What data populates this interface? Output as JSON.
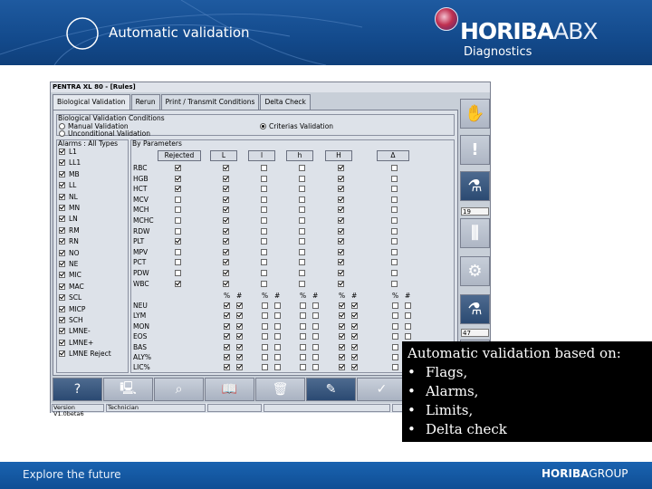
{
  "slide": {
    "title": "Automatic validation",
    "logo_bold": "HORIBA",
    "logo_light": "ABX",
    "logo_sub": "Diagnostics",
    "footer_text": "Explore the future",
    "footer_logo_bold": "HORIBA",
    "footer_logo_light": "GROUP"
  },
  "app": {
    "title": "PENTRA XL 80 - [Rules]",
    "tabs": [
      "Biological Validation",
      "Rerun",
      "Print / Transmit Conditions",
      "Delta Check"
    ],
    "conditions_label": "Biological Validation Conditions",
    "radio": {
      "manual": "Manual Validation",
      "unconditional": "Unconditional Validation",
      "criterias": "Criterias Validation"
    },
    "alarms_label": "Alarms : All Types",
    "alarms": [
      "L1",
      "LL1",
      "MB",
      "LL",
      "NL",
      "MN",
      "LN",
      "RM",
      "RN",
      "NO",
      "NE",
      "MIC",
      "MAC",
      "SCL",
      "MICP",
      "SCH",
      "LMNE-",
      "LMNE+",
      "LMNE Reject"
    ],
    "params_label": "By Parameters",
    "columns": [
      "Rejected",
      "L",
      "l",
      "h",
      "H",
      "Δ"
    ],
    "params_top": [
      "RBC",
      "HGB",
      "HCT",
      "MCV",
      "MCH",
      "MCHC",
      "RDW",
      "PLT",
      "MPV",
      "PCT",
      "PDW",
      "WBC"
    ],
    "rejected_checked": [
      "RBC",
      "HGB",
      "HCT",
      "PLT",
      "WBC"
    ],
    "params_bottom": [
      "NEU",
      "LYM",
      "MON",
      "EOS",
      "BAS",
      "ALY%",
      "LIC%"
    ],
    "sub_cols": [
      "%",
      "#"
    ],
    "side_fields": [
      "19",
      "47"
    ],
    "status": {
      "version": "Version V1.0beta6",
      "user": "Technician"
    }
  },
  "info": {
    "heading": "Automatic validation based on:",
    "items": [
      "Flags,",
      "Alarms,",
      "Limits,",
      "Delta check"
    ]
  }
}
